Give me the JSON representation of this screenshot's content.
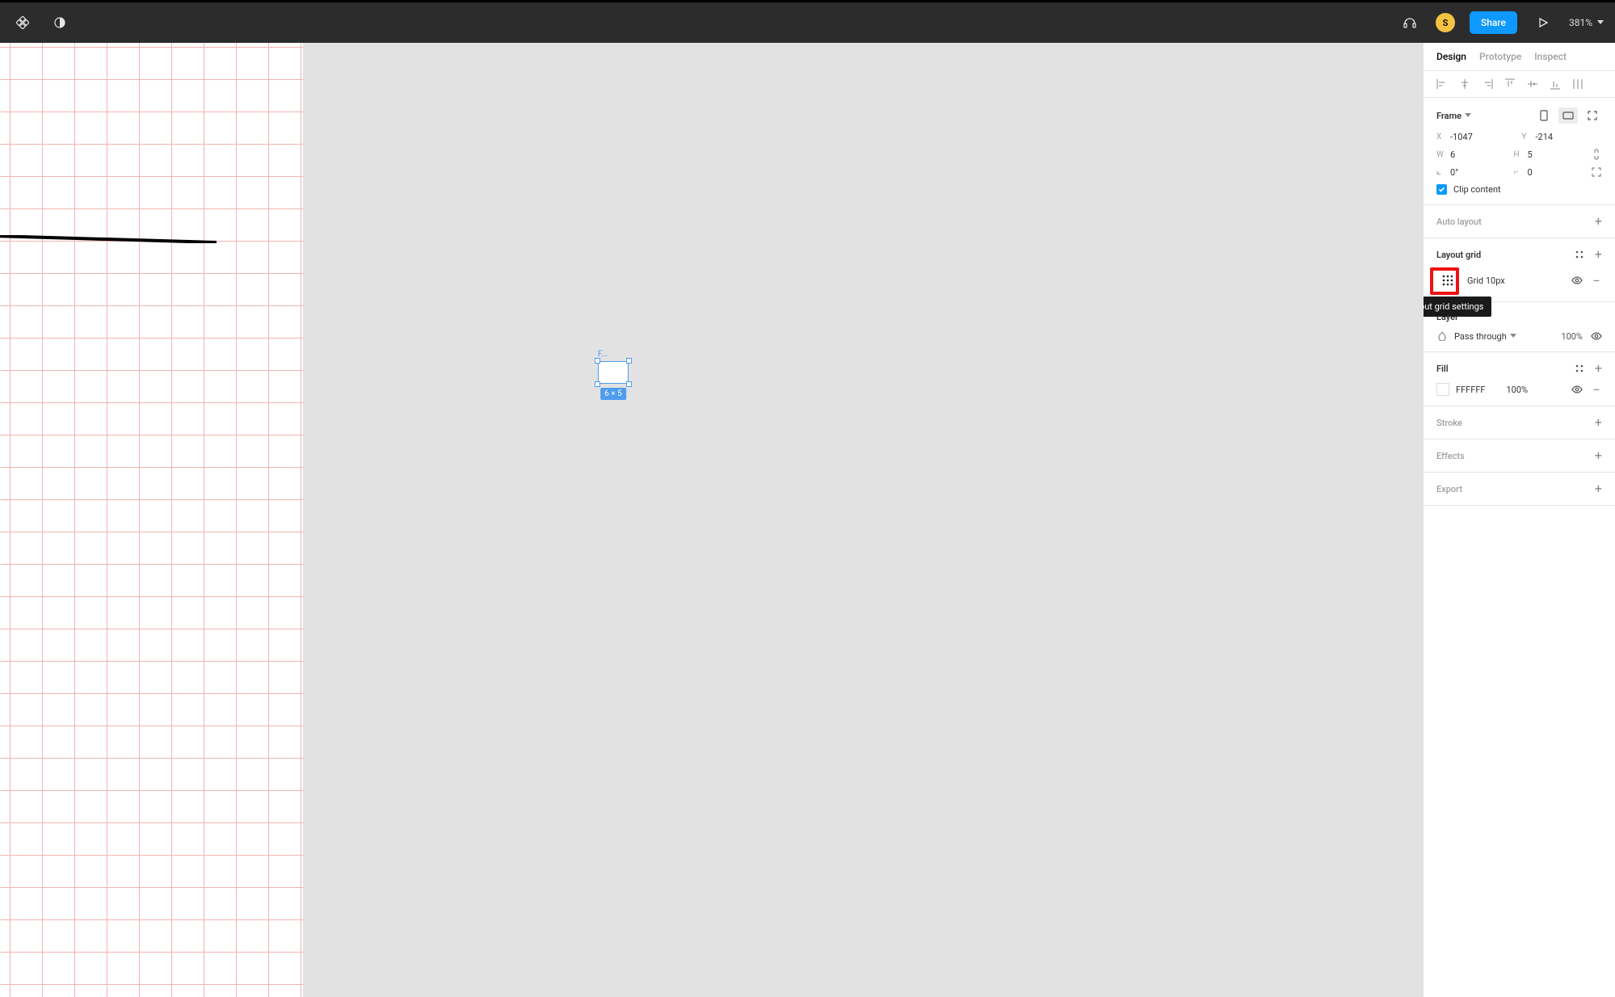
{
  "toolbar": {
    "avatar_initial": "S",
    "share_label": "Share",
    "zoom_label": "381%"
  },
  "tabs": {
    "design": "Design",
    "prototype": "Prototype",
    "inspect": "Inspect"
  },
  "frame_panel": {
    "title": "Frame",
    "x_label": "X",
    "x_value": "-1047",
    "y_label": "Y",
    "y_value": "-214",
    "w_label": "W",
    "w_value": "6",
    "h_label": "H",
    "h_value": "5",
    "rot_value": "0°",
    "radius_value": "0",
    "clip_label": "Clip content"
  },
  "auto_layout": {
    "title": "Auto layout"
  },
  "layout_grid": {
    "title": "Layout grid",
    "item_label": "Grid 10px",
    "tooltip": "Layout grid settings"
  },
  "layer": {
    "title": "Layer",
    "blend_mode": "Pass through",
    "opacity": "100%"
  },
  "fill": {
    "title": "Fill",
    "hex": "FFFFFF",
    "opacity": "100%"
  },
  "stroke": {
    "title": "Stroke"
  },
  "effects": {
    "title": "Effects"
  },
  "export": {
    "title": "Export"
  },
  "canvas": {
    "frame_label": "F...",
    "dimensions_label": "6 × 5"
  }
}
